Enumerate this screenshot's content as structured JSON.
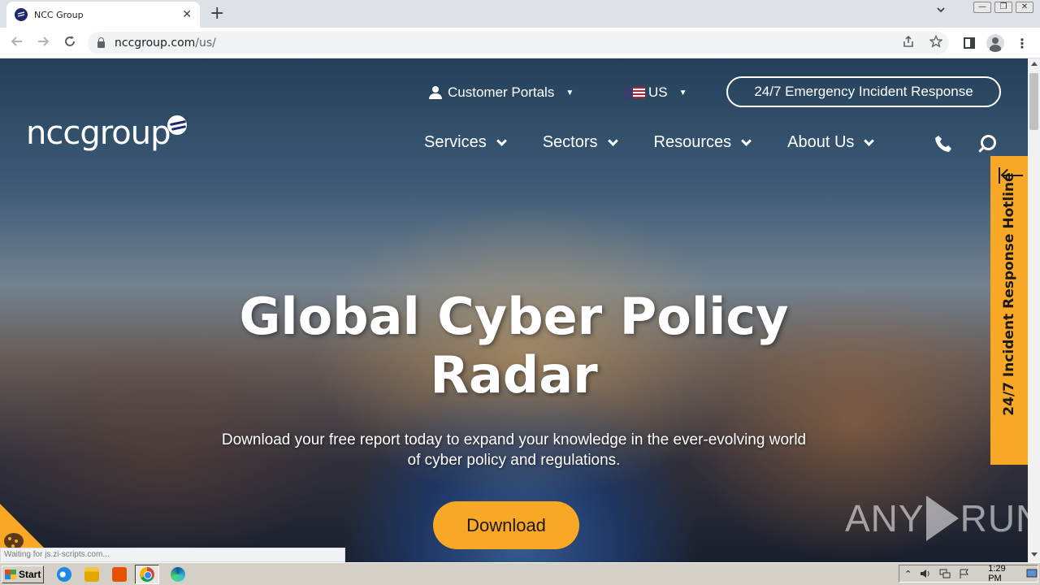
{
  "browser": {
    "tab_title": "NCC Group",
    "tab_close": "✕",
    "new_tab": "+",
    "url_host": "nccgroup.com",
    "url_path": "/us/"
  },
  "site": {
    "logo_text": "nccgroup",
    "utility": {
      "customer_portals": "Customer Portals",
      "region": "US",
      "emergency": "24/7 Emergency Incident Response"
    },
    "nav": [
      {
        "label": "Services"
      },
      {
        "label": "Sectors"
      },
      {
        "label": "Resources"
      },
      {
        "label": "About Us"
      }
    ],
    "hero": {
      "title_line1": "Global Cyber Policy",
      "title_line2": "Radar",
      "subtitle_line1": "Download your free report today to expand your knowledge in the ever-evolving world",
      "subtitle_line2": "of cyber policy and regulations.",
      "cta": "Download"
    },
    "hotline": "24/7 Incident Response Hotline",
    "status_text": "Waiting for js.zi-scripts.com...",
    "colors": {
      "accent": "#f9a825",
      "brand_navy": "#1c2a6b"
    }
  },
  "watermark": {
    "left": "ANY",
    "right": "RUN"
  },
  "taskbar": {
    "start": "Start",
    "clock": "1:29 PM"
  }
}
